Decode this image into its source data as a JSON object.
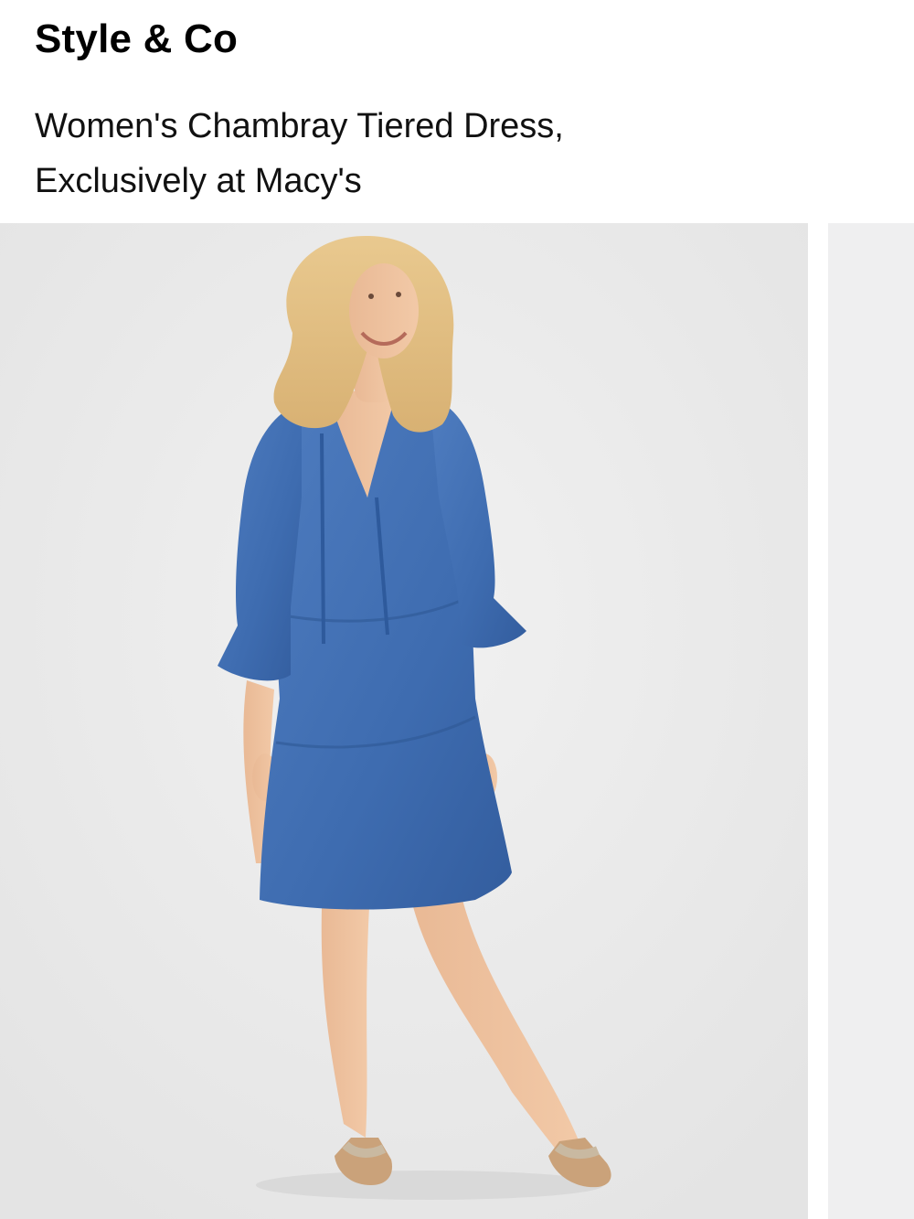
{
  "product": {
    "brand": "Style & Co",
    "title_line1": "Women's Chambray Tiered Dress,",
    "title_line2": "Exclusively at Macy's"
  },
  "gallery": {
    "main_image": "product-photo",
    "peek_image": "next-product-photo"
  },
  "colors": {
    "background": "#ececec",
    "dress": "#3f6db0",
    "text": "#111111"
  }
}
